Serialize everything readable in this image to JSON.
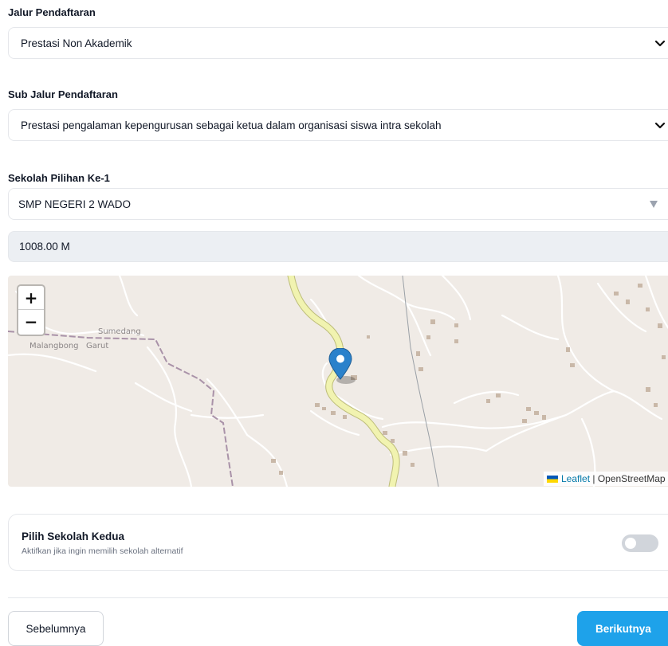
{
  "form": {
    "jalur": {
      "label": "Jalur Pendaftaran",
      "value": "Prestasi Non Akademik"
    },
    "sub_jalur": {
      "label": "Sub Jalur Pendaftaran",
      "value": "Prestasi pengalaman kepengurusan sebagai ketua dalam organisasi siswa intra sekolah"
    },
    "sekolah_1": {
      "label": "Sekolah Pilihan Ke-1",
      "value": "SMP NEGERI 2 WADO"
    },
    "distance": "1008.00 M"
  },
  "map": {
    "zoom_in": "+",
    "zoom_out": "−",
    "places": [
      "Sumedang",
      "Malangbong",
      "Garut"
    ],
    "attribution": {
      "leaflet": "Leaflet",
      "separator": " | ",
      "osm": "OpenStreetMap"
    }
  },
  "second_school": {
    "title": "Pilih Sekolah Kedua",
    "subtitle": "Aktifkan jika ingin memilih sekolah alternatif",
    "enabled": false
  },
  "nav": {
    "prev_label": "Sebelumnya",
    "next_label": "Berikutnya"
  },
  "colors": {
    "primary": "#1ea2ea",
    "pin": "#2a81cb",
    "road_major": "#f1f3b0",
    "boundary": "#a992a8"
  },
  "icons": {
    "select_arrow": "chevron-down-icon",
    "combo_arrow": "triangle-down-icon",
    "pin": "map-marker-icon"
  }
}
